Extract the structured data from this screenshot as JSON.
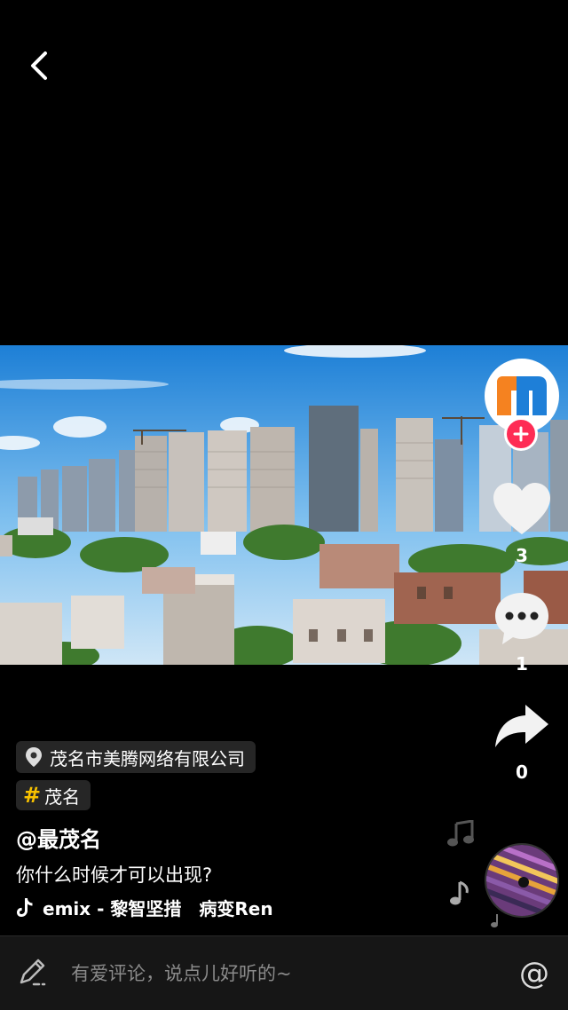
{
  "nav": {
    "back_icon": "chevron-left-icon"
  },
  "video": {
    "scene": "city-skyline-frame"
  },
  "side": {
    "avatar_icon": "m-logo-icon",
    "follow_icon": "plus-icon",
    "like_count": "3",
    "comment_count": "1",
    "share_count": "0"
  },
  "location": {
    "label": "茂名市美腾网络有限公司",
    "icon": "location-pin-icon"
  },
  "hashtag": {
    "symbol": "#",
    "label": "茂名"
  },
  "author": {
    "name": "@最茂名"
  },
  "caption": {
    "text": "你什么时候才可以出现?"
  },
  "music": {
    "icon": "tiktok-note-icon",
    "text": "emix - 黎智坚措　病变Ren"
  },
  "comment_bar": {
    "placeholder": "有爱评论，说点儿好听的~",
    "at_label": "@"
  },
  "colors": {
    "accent": "#fe2c55",
    "hashtag": "#f8c200",
    "bar_bg": "#161616"
  }
}
